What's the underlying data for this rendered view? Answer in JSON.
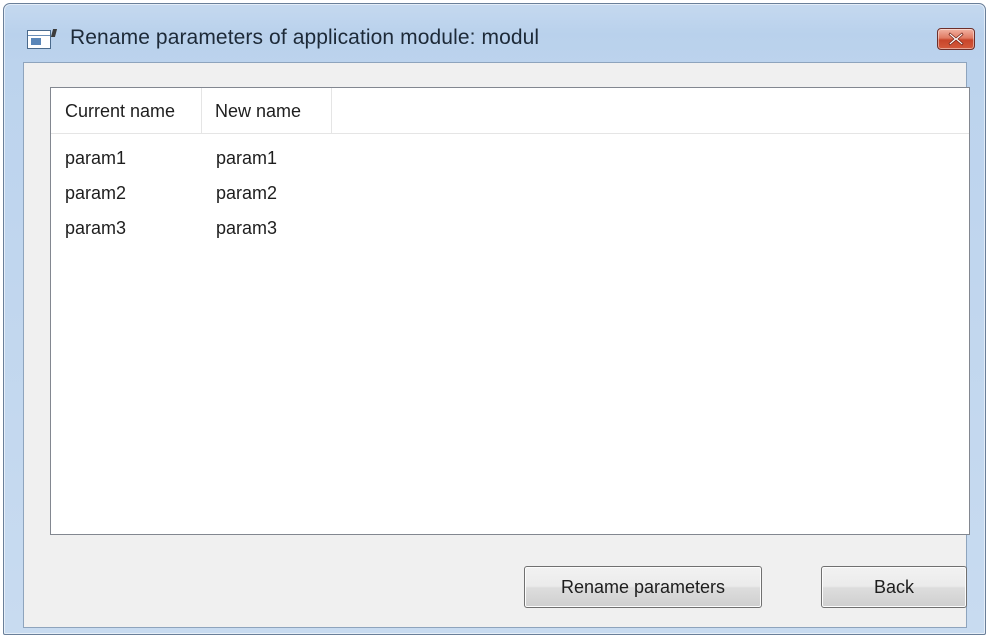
{
  "window": {
    "title": "Rename parameters of application module: modul",
    "icon": "application-window-icon",
    "close_icon": "close-icon",
    "accent_color": "#c5d9ef",
    "close_color": "#c8452a"
  },
  "list": {
    "columns": [
      {
        "label": "Current name"
      },
      {
        "label": "New name"
      }
    ],
    "rows": [
      {
        "current": "param1",
        "new": "param1"
      },
      {
        "current": "param2",
        "new": "param2"
      },
      {
        "current": "param3",
        "new": "param3"
      }
    ]
  },
  "buttons": {
    "rename_label": "Rename parameters",
    "back_label": "Back"
  }
}
